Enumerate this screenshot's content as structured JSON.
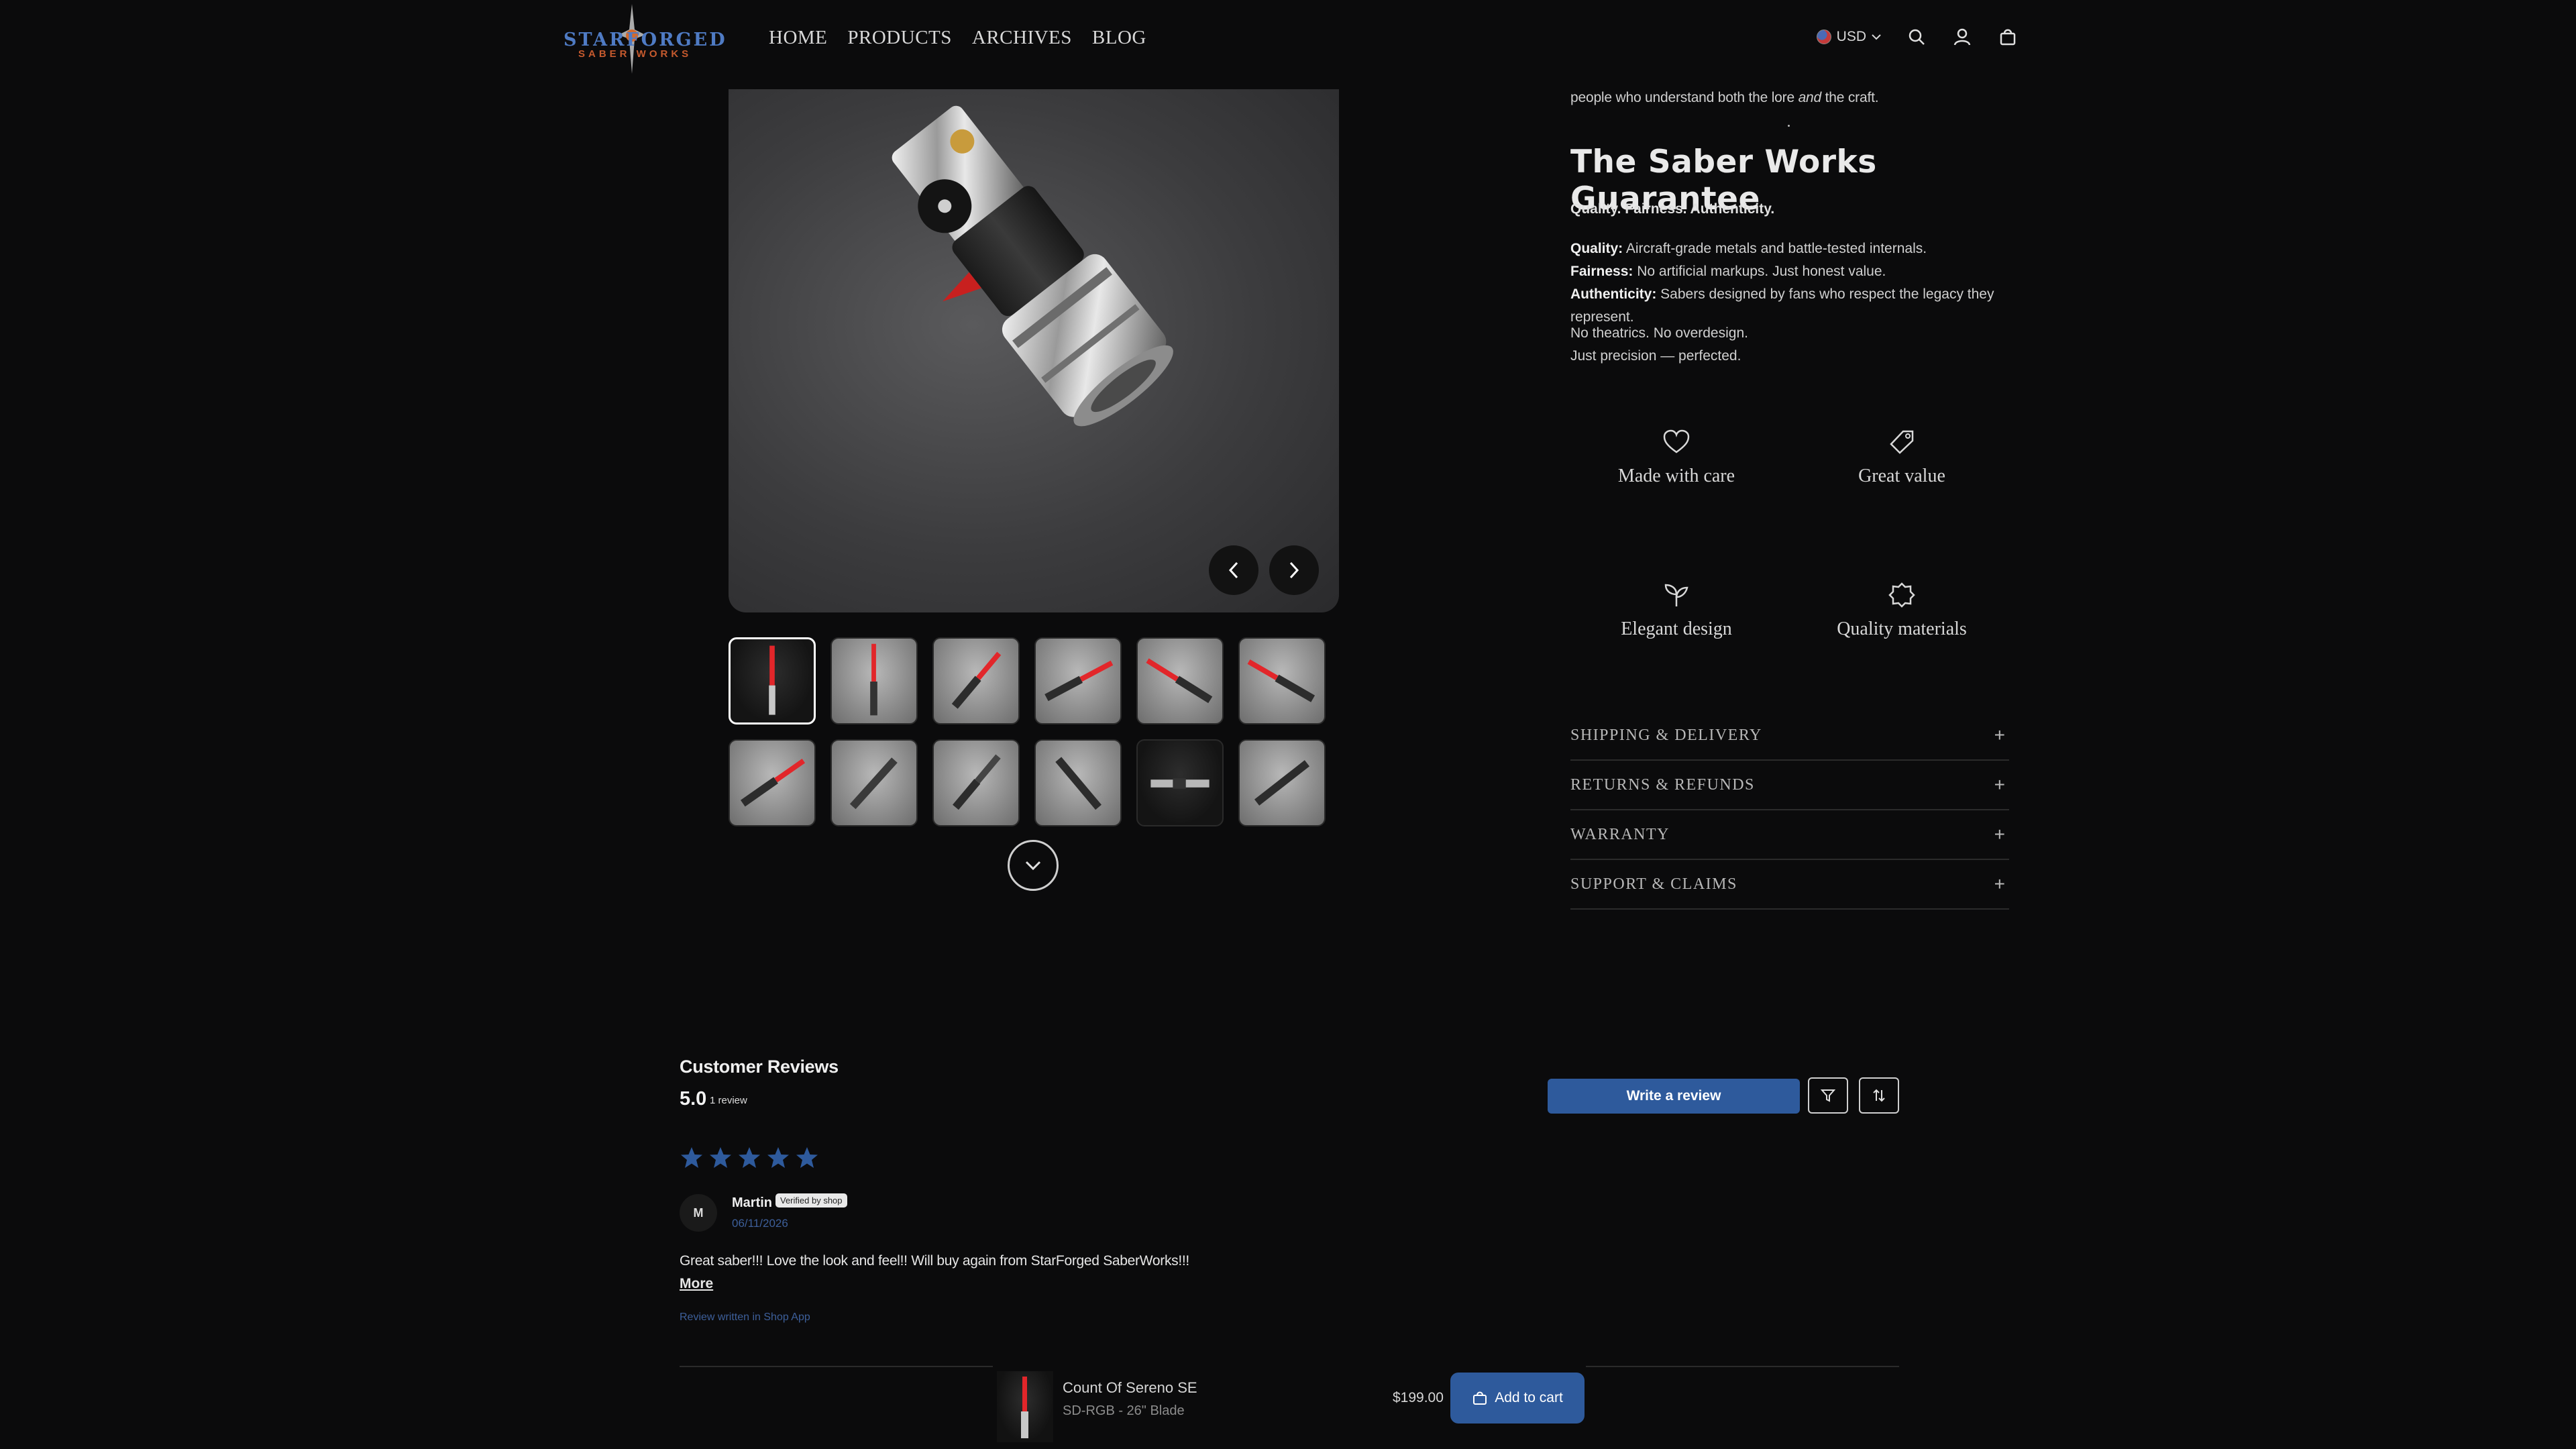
{
  "header": {
    "logo_line1": "STARFORGED",
    "logo_line2": "SABER WORKS",
    "nav": [
      "HOME",
      "PRODUCTS",
      "ARCHIVES",
      "BLOG"
    ],
    "currency": "USD",
    "icons": [
      "search-icon",
      "account-icon",
      "cart-icon"
    ]
  },
  "gallery": {
    "prev_icon": "chevron-left-icon",
    "next_icon": "chevron-right-icon",
    "thumbnail_count": 12,
    "more_icon": "chevron-down-icon"
  },
  "guarantee": {
    "lore_prefix": "people who understand both the lore ",
    "lore_em": "and",
    "lore_suffix": " the craft.",
    "title": "The Saber Works Guarantee",
    "subtitle": "Quality. Fairness. Authenticity.",
    "lines": [
      {
        "label": "Quality:",
        "text": " Aircraft-grade metals and battle-tested internals."
      },
      {
        "label": "Fairness:",
        "text": " No artificial markups. Just honest value."
      },
      {
        "label": "Authenticity:",
        "text": " Sabers designed by fans who respect the legacy they represent."
      }
    ],
    "closing": [
      "No theatrics. No overdesign.",
      "Just precision — perfected."
    ]
  },
  "features": [
    {
      "label": "Made with care",
      "icon": "heart-icon"
    },
    {
      "label": "Great value",
      "icon": "tag-icon"
    },
    {
      "label": "Elegant design",
      "icon": "sprout-icon"
    },
    {
      "label": "Quality materials",
      "icon": "badge-icon"
    }
  ],
  "accordion": [
    {
      "label": "SHIPPING & DELIVERY",
      "icon": "plus"
    },
    {
      "label": "RETURNS & REFUNDS",
      "icon": "plus"
    },
    {
      "label": "WARRANTY",
      "icon": "plus"
    },
    {
      "label": "SUPPORT & CLAIMS",
      "icon": "plus"
    }
  ],
  "reviews": {
    "title": "Customer Reviews",
    "score": "5.0",
    "count": "1 review",
    "write_label": "Write a review",
    "filter_icon": "filter-icon",
    "sort_icon": "sort-icon",
    "star_rating": 5,
    "star_color": "#2e5a9c",
    "items": [
      {
        "avatar": "M",
        "name": "Martin",
        "badge": "Verified by shop",
        "date": "06/11/2026",
        "body": "Great saber!!! Love the look and feel!! Will buy again from StarForged SaberWorks!!!",
        "more": "More",
        "source": "Review written in Shop App"
      }
    ]
  },
  "sticky_bar": {
    "product_name": "Count Of Sereno SE",
    "variant": "SD-RGB - 26\" Blade",
    "price": "$199.00",
    "cart_label": "Add to cart"
  },
  "colors": {
    "accent": "#2e5a9c",
    "background": "#0b0b0c",
    "blade": "#d8282b"
  }
}
